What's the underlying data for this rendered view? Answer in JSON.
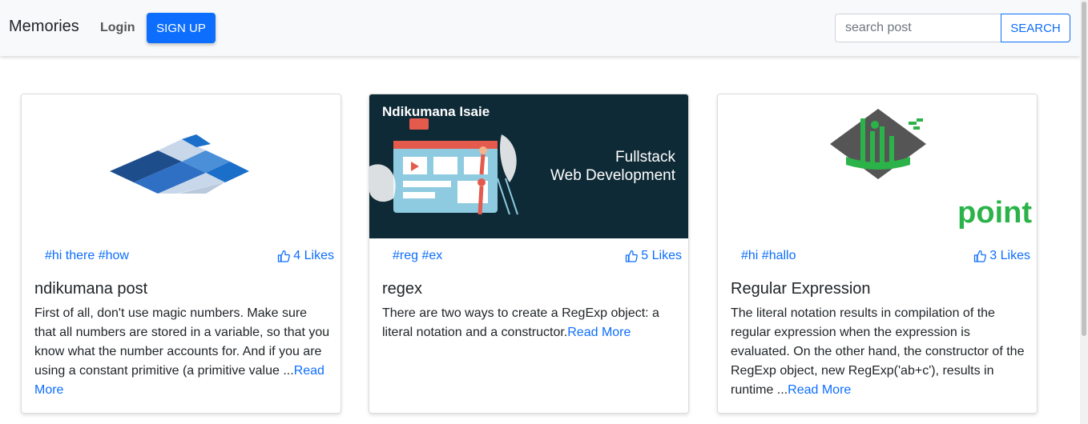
{
  "navbar": {
    "brand": "Memories",
    "login": "Login",
    "signup": "SIGN UP",
    "search_placeholder": "search post",
    "search_button": "SEARCH"
  },
  "posts": [
    {
      "image_caption": "",
      "tags": "#hi there #how",
      "likes": "4 Likes",
      "title": "ndikumana post",
      "text": "First of all, don't use magic numbers. Make sure that all numbers are stored in a variable, so that you know what the number accounts for. And if you are using a constant primitive (a primitive value ...",
      "read_more": "Read More"
    },
    {
      "image_author": "Ndikumana Isaie",
      "image_line1": "Fullstack",
      "image_line2": "Web Development",
      "tags": "#reg #ex",
      "likes": "5 Likes",
      "title": "regex",
      "text": "There are two ways to create a RegExp object: a literal notation and a constructor.",
      "read_more": "Read More"
    },
    {
      "image_logo_text": "point",
      "tags": "#hi #hallo",
      "likes": "3 Likes",
      "title": "Regular Expression",
      "text": "The literal notation results in compilation of the regular expression when the expression is evaluated. On the other hand, the constructor of the RegExp object, new RegExp('ab+c'), results in runtime ...",
      "read_more": "Read More"
    }
  ],
  "colors": {
    "primary": "#0d6efd",
    "navbar_bg": "#f8f9fa",
    "banner_bg": "#0e2a36",
    "logo_green": "#2bb34a"
  },
  "icons": [
    "thumbs-up-icon"
  ]
}
